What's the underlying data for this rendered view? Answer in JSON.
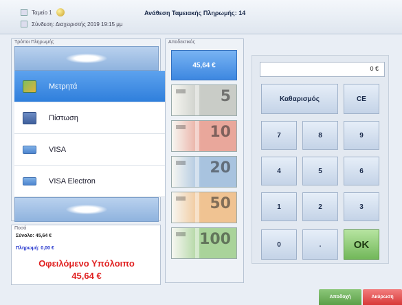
{
  "header": {
    "row1_label": "Ταμείο 1",
    "row2_label": "Σύνδεση: Διαχειριστής 2019 19:15 μμ",
    "title": "Ανάθεση Ταμειακής Πληρωμής: 14"
  },
  "methods": {
    "caption": "Τρόποι Πληρωμής",
    "items": [
      {
        "label": "Μετρητά",
        "icon": "cash-icon"
      },
      {
        "label": "Πίστωση",
        "icon": "credit-icon"
      },
      {
        "label": "VISA",
        "icon": "card-icon"
      },
      {
        "label": "VISA Electron",
        "icon": "card-icon"
      }
    ]
  },
  "summary": {
    "caption": "Ποσά",
    "total_text": "Σύνολο: 45,64 €",
    "paid_text": "Πληρωμή: 0,00 €",
    "due_label": "Οφειλόμενο Υπόλοιπο",
    "due_value": "45,64 €"
  },
  "amounts": {
    "caption": "Αποδεκτικός",
    "amount_button": "45,64 €",
    "notes": [
      {
        "value": "5",
        "color": "#c9ccc7"
      },
      {
        "value": "10",
        "color": "#e9a79b"
      },
      {
        "value": "20",
        "color": "#a8c3df"
      },
      {
        "value": "50",
        "color": "#f0c392"
      },
      {
        "value": "100",
        "color": "#a9d39a"
      }
    ]
  },
  "keypad": {
    "display": "0 €",
    "clear_label": "Καθαρισμός",
    "ce_label": "CE",
    "keys": [
      "7",
      "8",
      "9",
      "4",
      "5",
      "6",
      "1",
      "2",
      "3",
      "0",
      "."
    ],
    "ok_label": "OK"
  },
  "footer": {
    "accept_label": "Αποδοχή",
    "cancel_label": "Ακύρωση"
  },
  "colors": {
    "accent": "#3d87e0",
    "due": "#e02020",
    "ok": "#72b75a",
    "cancel": "#d83838"
  }
}
